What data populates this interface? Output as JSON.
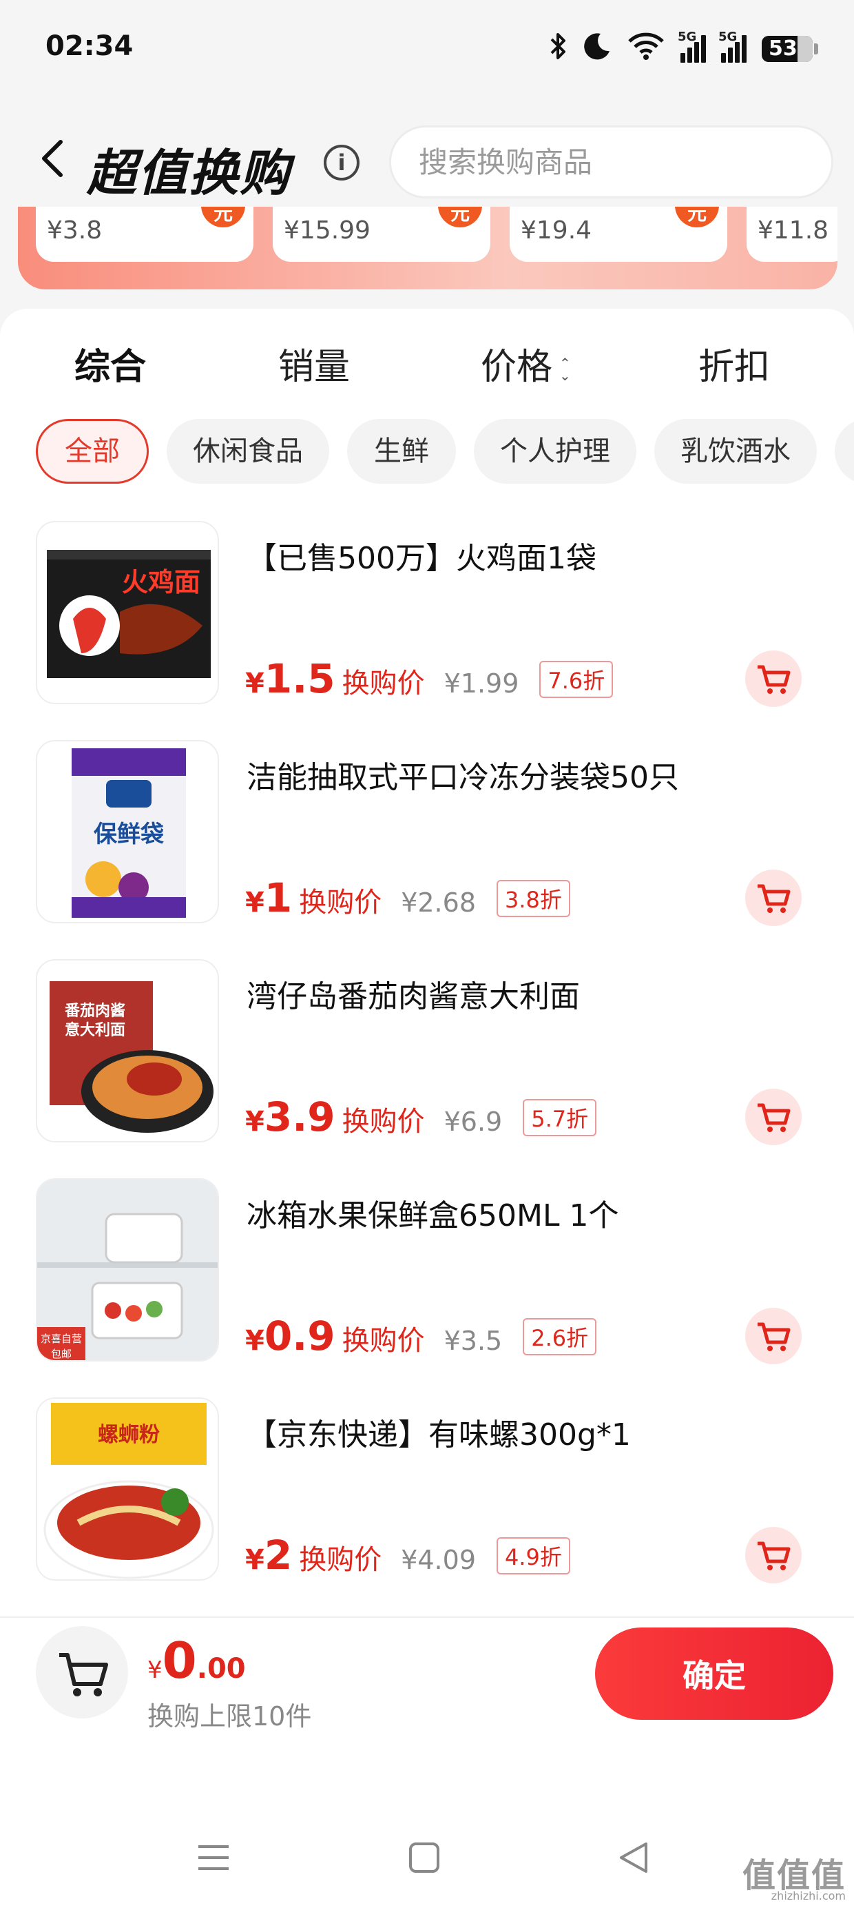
{
  "status_bar": {
    "time": "02:34",
    "network_1": "5G",
    "network_2": "5G",
    "battery": "53"
  },
  "header": {
    "title": "超值换购",
    "search_placeholder": "搜索换购商品"
  },
  "banner_cards": [
    {
      "price": "¥3.8",
      "badge": "元"
    },
    {
      "price": "¥15.99",
      "badge": "元"
    },
    {
      "price": "¥19.4",
      "badge": "元"
    },
    {
      "price": "¥11.8"
    }
  ],
  "sort_tabs": [
    {
      "label": "综合",
      "active": true
    },
    {
      "label": "销量"
    },
    {
      "label": "价格"
    },
    {
      "label": "折扣"
    }
  ],
  "categories": [
    {
      "label": "全部",
      "active": true
    },
    {
      "label": "休闲食品"
    },
    {
      "label": "生鲜"
    },
    {
      "label": "个人护理"
    },
    {
      "label": "乳饮酒水"
    }
  ],
  "products": [
    {
      "name": "【已售500万】火鸡面1袋",
      "price_symbol": "¥",
      "price": "1.5",
      "price_label": "换购价",
      "original": "¥1.99",
      "discount": "7.6折",
      "image_text": "火鸡面"
    },
    {
      "name": "洁能抽取式平口冷冻分装袋50只",
      "price_symbol": "¥",
      "price": "1",
      "price_label": "换购价",
      "original": "¥2.68",
      "discount": "3.8折",
      "image_text": "保鲜袋"
    },
    {
      "name": "湾仔岛番茄肉酱意大利面",
      "price_symbol": "¥",
      "price": "3.9",
      "price_label": "换购价",
      "original": "¥6.9",
      "discount": "5.7折",
      "image_text": "番茄肉酱意大利面"
    },
    {
      "name": "冰箱水果保鲜盒650ML 1个",
      "price_symbol": "¥",
      "price": "0.9",
      "price_label": "换购价",
      "original": "¥3.5",
      "discount": "2.6折",
      "image_text": "京喜自营 包邮"
    },
    {
      "name": "【京东快递】有味螺300g*1",
      "price_symbol": "¥",
      "price": "2",
      "price_label": "换购价",
      "original": "¥4.09",
      "discount": "4.9折",
      "image_text": "螺蛳粉"
    }
  ],
  "bottom": {
    "currency": "¥",
    "total_int": "0",
    "total_dec": ".00",
    "limit": "换购上限10件",
    "confirm": "确定"
  },
  "watermark": {
    "main": "值值值",
    "sub": "zhizhizhi.com"
  },
  "colors": {
    "accent": "#e0261b",
    "confirm_start": "#fb3b3b",
    "confirm_end": "#ec2232",
    "banner": "#f98d7c"
  }
}
